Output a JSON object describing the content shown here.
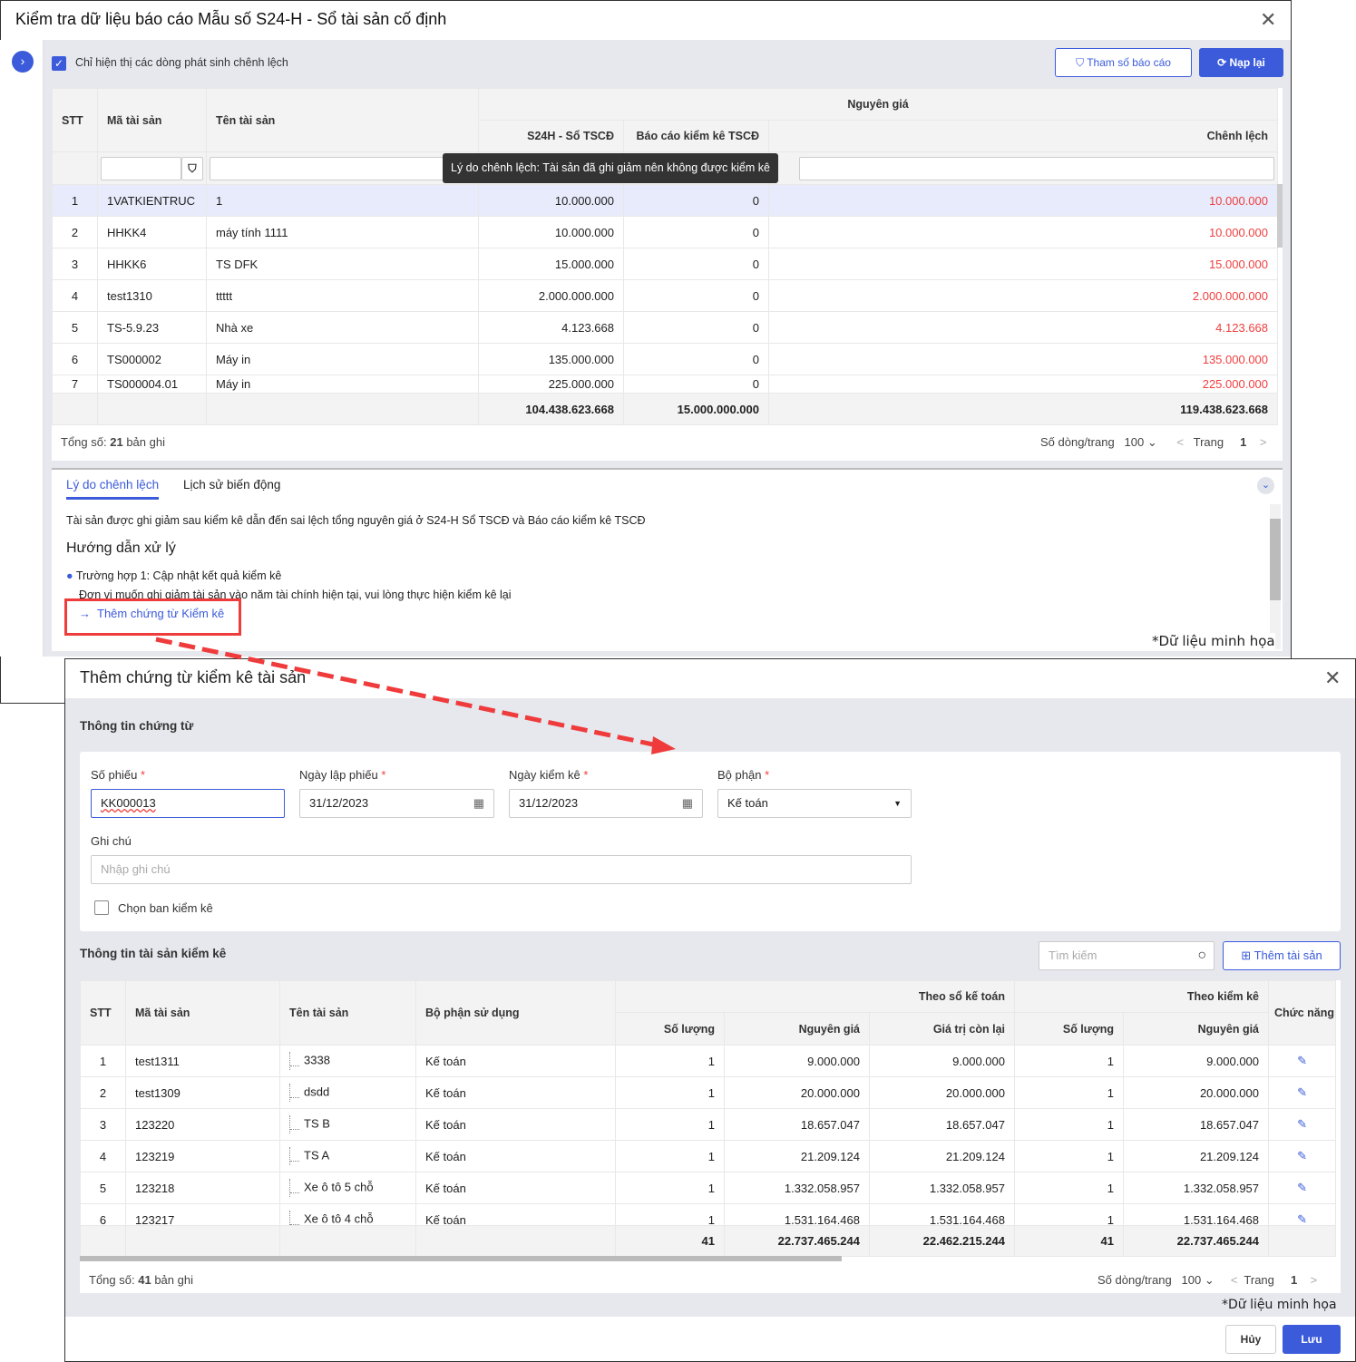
{
  "report": {
    "title": "Kiểm tra dữ liệu báo cáo Mẫu số S24-H - Sổ tài sản cố định",
    "show_diff_only": "Chỉ hiện thị các dòng phát sinh chênh lệch",
    "params_btn": "Tham số báo cáo",
    "reload_btn": "Nạp lại",
    "headers": {
      "stt": "STT",
      "code": "Mã tài sản",
      "name": "Tên tài sản",
      "group": "Nguyên giá",
      "s24h": "S24H - Sổ TSCĐ",
      "inventory": "Báo cáo kiểm kê TSCĐ",
      "diff": "Chênh lệch"
    },
    "tooltip": "Lý do chênh lệch: Tài sản đã ghi giảm nên không được kiểm kê",
    "rows": [
      [
        "1",
        "1VATKIENTRUC",
        "1",
        "10.000.000",
        "0",
        "10.000.000"
      ],
      [
        "2",
        "HHKK4",
        "máy tính 1111",
        "10.000.000",
        "0",
        "10.000.000"
      ],
      [
        "3",
        "HHKK6",
        "TS DFK",
        "15.000.000",
        "0",
        "15.000.000"
      ],
      [
        "4",
        "test1310",
        "ttttt",
        "2.000.000.000",
        "0",
        "2.000.000.000"
      ],
      [
        "5",
        "TS-5.9.23",
        "Nhà xe",
        "4.123.668",
        "0",
        "4.123.668"
      ],
      [
        "6",
        "TS000002",
        "Máy in",
        "135.000.000",
        "0",
        "135.000.000"
      ],
      [
        "7",
        "TS000004.01",
        "Máy in",
        "225.000.000",
        "0",
        "225.000.000"
      ]
    ],
    "totals": {
      "s24h": "104.438.623.668",
      "inventory": "15.000.000.000",
      "diff": "119.438.623.668"
    },
    "footer": {
      "total_label": "Tổng số:",
      "total_count": "21",
      "total_suffix": "bản ghi",
      "per_page_label": "Số dòng/trang",
      "per_page": "100",
      "page_label": "Trang",
      "page": "1"
    },
    "tabs": [
      "Lý do chênh lệch",
      "Lịch sử biến động"
    ],
    "reason": "Tài sản được ghi giảm sau kiểm kê dẫn đến sai lệch tổng nguyên giá ở S24-H Sổ TSCĐ và Báo cáo kiểm kê TSCĐ",
    "guide_title": "Hướng dẫn xử lý",
    "case1": "Trường hợp 1: Cập nhật kết quả kiểm kê",
    "case1_desc": "Đơn vị muốn ghi giảm tài sản vào năm tài chính hiện tại, vui lòng thực hiện kiểm kê lại",
    "case1_link": "Thêm chứng từ Kiểm kê",
    "watermark": "*Dữ liệu minh họa"
  },
  "voucher": {
    "title": "Thêm chứng từ kiểm kê tài sản",
    "section1": "Thông tin chứng từ",
    "fields": {
      "so_phieu_label": "Số phiếu",
      "so_phieu": "KK000013",
      "ngay_lap_label": "Ngày lập phiếu",
      "ngay_lap": "31/12/2023",
      "ngay_kk_label": "Ngày kiểm kê",
      "ngay_kk": "31/12/2023",
      "bo_phan_label": "Bộ phận",
      "bo_phan": "Kế toán",
      "ghi_chu_label": "Ghi chú",
      "ghi_chu_placeholder": "Nhập ghi chú",
      "chon_ban": "Chọn ban kiểm kê"
    },
    "section2": "Thông tin tài sản kiểm kê",
    "search_placeholder": "Tìm kiếm",
    "add_asset": "Thêm tài sản",
    "headers": {
      "stt": "STT",
      "code": "Mã tài sản",
      "name": "Tên tài sản",
      "dept": "Bộ phận sử dụng",
      "book": "Theo sổ kế toán",
      "inv": "Theo kiểm kê",
      "qty": "Số lượng",
      "cost": "Nguyên giá",
      "remain": "Giá trị còn lại",
      "qty2": "Số lượng",
      "cost2": "Nguyên giá",
      "actions": "Chức năng"
    },
    "rows": [
      [
        "1",
        "test1311",
        "3338",
        "Kế toán",
        "1",
        "9.000.000",
        "9.000.000",
        "1",
        "9.000.000"
      ],
      [
        "2",
        "test1309",
        "dsdd",
        "Kế toán",
        "1",
        "20.000.000",
        "20.000.000",
        "1",
        "20.000.000"
      ],
      [
        "3",
        "123220",
        "TS B",
        "Kế toán",
        "1",
        "18.657.047",
        "18.657.047",
        "1",
        "18.657.047"
      ],
      [
        "4",
        "123219",
        "TS A",
        "Kế toán",
        "1",
        "21.209.124",
        "21.209.124",
        "1",
        "21.209.124"
      ],
      [
        "5",
        "123218",
        "Xe ô tô 5 chỗ",
        "Kế toán",
        "1",
        "1.332.058.957",
        "1.332.058.957",
        "1",
        "1.332.058.957"
      ],
      [
        "6",
        "123217",
        "Xe ô tô 4 chỗ",
        "Kế toán",
        "1",
        "1.531.164.468",
        "1.531.164.468",
        "1",
        "1.531.164.468"
      ]
    ],
    "totals": {
      "qty": "41",
      "cost": "22.737.465.244",
      "remain": "22.462.215.244",
      "qty2": "41",
      "cost2": "22.737.465.244"
    },
    "footer": {
      "total_label": "Tổng số:",
      "total_count": "41",
      "total_suffix": "bản ghi",
      "per_page_label": "Số dòng/trang",
      "per_page": "100",
      "page_label": "Trang",
      "page": "1"
    },
    "watermark": "*Dữ liệu minh họa",
    "cancel": "Hủy",
    "save": "Lưu"
  },
  "colors": {
    "accent": "#3b5bdb",
    "diff": "#f03e3e",
    "highlight": "#ef3b3b"
  }
}
